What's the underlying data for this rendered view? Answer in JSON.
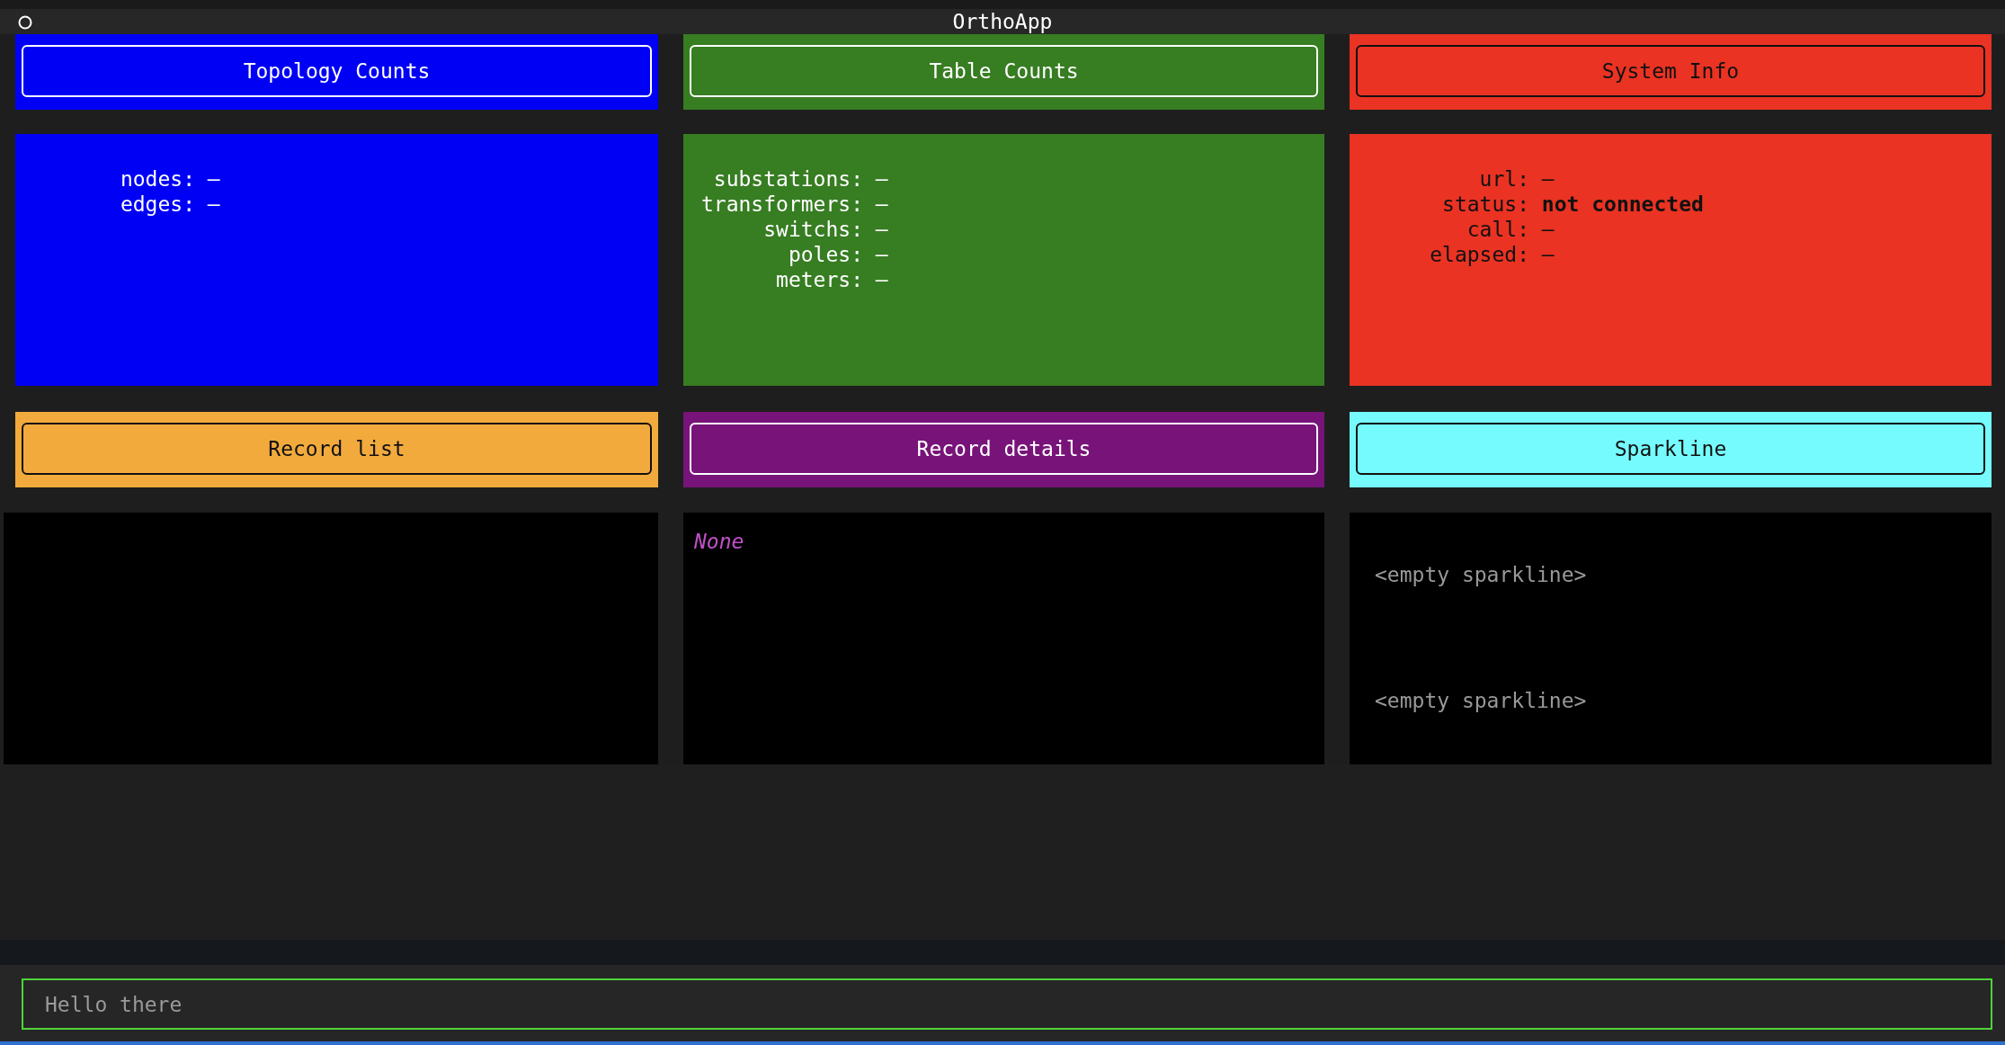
{
  "window": {
    "title": "OrthoApp"
  },
  "top_panels": [
    {
      "title": "Topology Counts",
      "color": "#0000f5",
      "dark_text": false,
      "lines": [
        "nodes: –",
        "edges: –"
      ]
    },
    {
      "title": "Table Counts",
      "color": "#377d22",
      "dark_text": false,
      "lines": [
        "substations: –",
        "transformers: –",
        "switchs: –",
        "poles: –",
        "meters: –"
      ]
    },
    {
      "title": "System Info",
      "color": "#ea3323",
      "dark_text": true,
      "lines": [
        "url: –",
        "status: **not connected**",
        "call: –",
        "elapsed: –"
      ]
    }
  ],
  "bottom_panels": [
    {
      "title": "Record list",
      "color": "#f2aa3d",
      "dark_text": true,
      "kind": "list"
    },
    {
      "title": "Record details",
      "color": "#781479",
      "dark_text": false,
      "kind": "details",
      "text": "None"
    },
    {
      "title": "Sparkline",
      "color": "#75fbfd",
      "dark_text": true,
      "kind": "sparkline",
      "lines": [
        "<empty sparkline>",
        "<empty sparkline>"
      ]
    }
  ],
  "input": {
    "placeholder": "Hello there"
  }
}
